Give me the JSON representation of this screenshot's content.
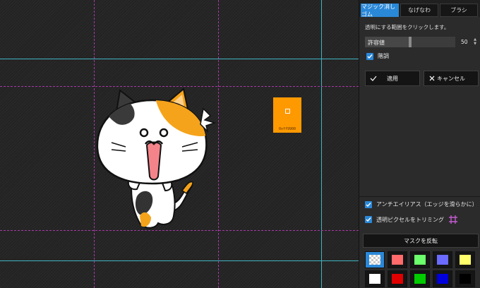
{
  "tabs": [
    {
      "label": "マジック消しゴム",
      "active": true
    },
    {
      "label": "なげなわ",
      "active": false
    },
    {
      "label": "ブラシ",
      "active": false
    }
  ],
  "hint": "透明にする範囲をクリックします。",
  "tolerance": {
    "label": "許容値",
    "value": "50",
    "level": 0.5
  },
  "gradation": {
    "label": "階調",
    "checked": true
  },
  "apply_label": "適用",
  "cancel_label": "キャンセル",
  "antialias": {
    "label": "アンチエイリアス（エッジを滑らかに）",
    "checked": true
  },
  "trim": {
    "label": "透明ピクセルをトリミング",
    "checked": true
  },
  "invert_label": "マスクを反転",
  "sample_color": {
    "hex": "0xff9900",
    "color": "#ff9900"
  },
  "mask_colors": [
    {
      "name": "transparent",
      "color": "checker",
      "selected": true
    },
    {
      "name": "light-red",
      "color": "#ff6b6b",
      "selected": false
    },
    {
      "name": "light-green",
      "color": "#6bff6b",
      "selected": false
    },
    {
      "name": "light-blue",
      "color": "#6b6bff",
      "selected": false
    },
    {
      "name": "light-yellow",
      "color": "#ffff6b",
      "selected": false
    },
    {
      "name": "white",
      "color": "#ffffff",
      "selected": false
    },
    {
      "name": "red",
      "color": "#e00000",
      "selected": false
    },
    {
      "name": "green",
      "color": "#00cc00",
      "selected": false
    },
    {
      "name": "blue",
      "color": "#0000dd",
      "selected": false
    },
    {
      "name": "black",
      "color": "#000000",
      "selected": false
    }
  ]
}
